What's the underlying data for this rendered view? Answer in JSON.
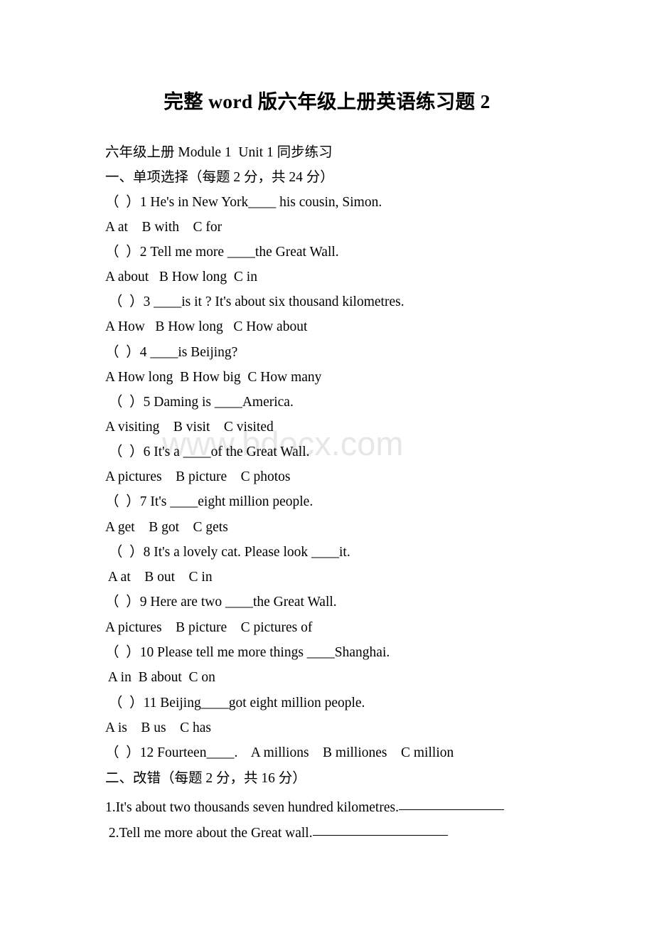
{
  "document": {
    "title": "完整 word 版六年级上册英语练习题 2",
    "watermark": "www.bdocx.com",
    "header_line": "六年级上册 Module 1  Unit 1 同步练习"
  },
  "section_one": {
    "heading": "一、单项选择（每题 2 分，共 24 分）",
    "questions": [
      {
        "stem": "（  ）1 He's in New York____ his cousin, Simon.",
        "options": "A at    B with    C for"
      },
      {
        "stem": "（  ）2 Tell me more ____the Great Wall.",
        "options": "A about   B How long  C in"
      },
      {
        "stem": " （  ）3 ____is it ? It's about six thousand kilometres.",
        "options": "A How   B How long   C How about"
      },
      {
        "stem": "（  ）4 ____is Beijing?",
        "options": "A How long  B How big  C How many"
      },
      {
        "stem": " （  ）5 Daming is ____America.",
        "options": "A visiting    B visit    C visited"
      },
      {
        "stem": " （  ）6 It's a ____of the Great Wall.",
        "options": "A pictures    B picture    C photos"
      },
      {
        "stem": "（  ）7 It's ____eight million people.",
        "options": "A get    B got    C gets"
      },
      {
        "stem": " （  ）8 It's a lovely cat. Please look ____it.",
        "options": " A at    B out    C in"
      },
      {
        "stem": "（  ）9 Here are two ____the Great Wall.",
        "options": "A pictures    B picture    C pictures of"
      },
      {
        "stem": "（  ）10 Please tell me more things ____Shanghai.",
        "options": " A in  B about  C on"
      },
      {
        "stem": " （  ）11 Beijing____got eight million people.",
        "options": "A is    B us    C has"
      },
      {
        "stem": "（  ）12 Fourteen____.    A millions    B milliones    C million",
        "options": ""
      }
    ]
  },
  "section_two": {
    "heading": "二、改错（每题 2 分，共 16 分）",
    "items": [
      {
        "text": "1.It's about two thousands seven hundred kilometres."
      },
      {
        "text": " 2.Tell me more about the Great wall."
      }
    ]
  }
}
